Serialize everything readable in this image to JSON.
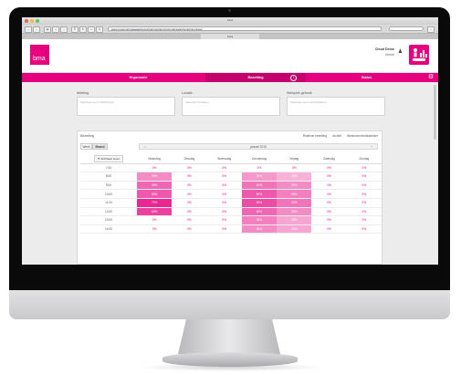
{
  "window": {
    "title": "bma",
    "url": "www.systemsbmaaaaa/wwwn/trainingplanning/organisatie/bezettingsgraad",
    "tab_label": "bma"
  },
  "header": {
    "logo": "bma",
    "user_name": "Cloud Demo",
    "user_org": "Utrecht",
    "brand_color": "#e5007e"
  },
  "nav": {
    "tabs": [
      {
        "label": "Ergonomie",
        "active": false
      },
      {
        "label": "Bezetting",
        "active": true
      },
      {
        "label": "Status",
        "active": false
      }
    ]
  },
  "filters": {
    "afdeling": {
      "label": "Afdeling",
      "placeholder": "Selecteer (een) afdeling(en)"
    },
    "locatie": {
      "label": "Locatie",
      "placeholder": "Selecteer locatie(s)"
    },
    "werkplek": {
      "label": "Werkplek gebruik",
      "placeholder": "Selecteer (een) werkplek(ken)"
    }
  },
  "bezetting": {
    "title": "Bezetting",
    "links": [
      "Realtime bezetting",
      "Archief",
      "Weekoverzicht/kalender"
    ],
    "view_buttons": [
      "Week",
      "Maand"
    ],
    "month_label": "januari 2015",
    "prev": "‹",
    "next": "›",
    "dropdown": "▼ Zichtbaar tonen",
    "days": [
      "Maandag",
      "Dinsdag",
      "Woensdag",
      "Donderdag",
      "Vrijdag",
      "Zaterdag",
      "Zondag"
    ],
    "rows": [
      {
        "time": "7:00",
        "values": [
          "0%",
          "0%",
          "0%",
          "0%",
          "0%",
          "0%",
          "0%"
        ]
      },
      {
        "time": "8:00",
        "values": [
          "30%",
          "0%",
          "0%",
          "25%",
          "15%",
          "0%",
          "0%"
        ]
      },
      {
        "time": "9:00",
        "values": [
          "45%",
          "0%",
          "0%",
          "40%",
          "30%",
          "0%",
          "0%"
        ]
      },
      {
        "time": "10:00",
        "values": [
          "50%",
          "0%",
          "0%",
          "50%",
          "35%",
          "0%",
          "0%"
        ]
      },
      {
        "time": "11:00",
        "values": [
          "70%",
          "0%",
          "0%",
          "55%",
          "40%",
          "0%",
          "0%"
        ]
      },
      {
        "time": "12:00",
        "values": [
          "60%",
          "0%",
          "0%",
          "45%",
          "30%",
          "0%",
          "0%"
        ]
      },
      {
        "time": "13:00",
        "values": [
          "0%",
          "0%",
          "0%",
          "35%",
          "20%",
          "0%",
          "0%"
        ]
      },
      {
        "time": "14:00",
        "values": [
          "0%",
          "0%",
          "0%",
          "30%",
          "20%",
          "0%",
          "0%"
        ]
      }
    ]
  }
}
